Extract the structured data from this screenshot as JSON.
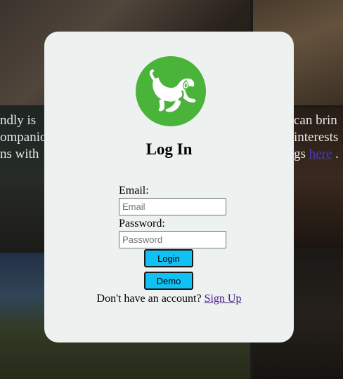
{
  "background": {
    "left_lines": [
      "ndly is",
      "ompanio",
      "ns with"
    ],
    "right_lines": [
      "can brin",
      "interests",
      "gs"
    ],
    "right_link": "here",
    "right_after_link": " ."
  },
  "modal": {
    "logo_icon": "dog-icon",
    "title": "Log In",
    "email_label": "Email:",
    "email_placeholder": "Email",
    "email_value": "",
    "password_label": "Password:",
    "password_placeholder": "Password",
    "password_value": "",
    "login_button": "Login",
    "demo_button": "Demo",
    "signup_prompt": "Don't have an account? ",
    "signup_link": "Sign Up"
  },
  "colors": {
    "logo_green": "#4ab43a",
    "button_cyan": "#12c1f3",
    "card_bg": "#edf1ef"
  }
}
